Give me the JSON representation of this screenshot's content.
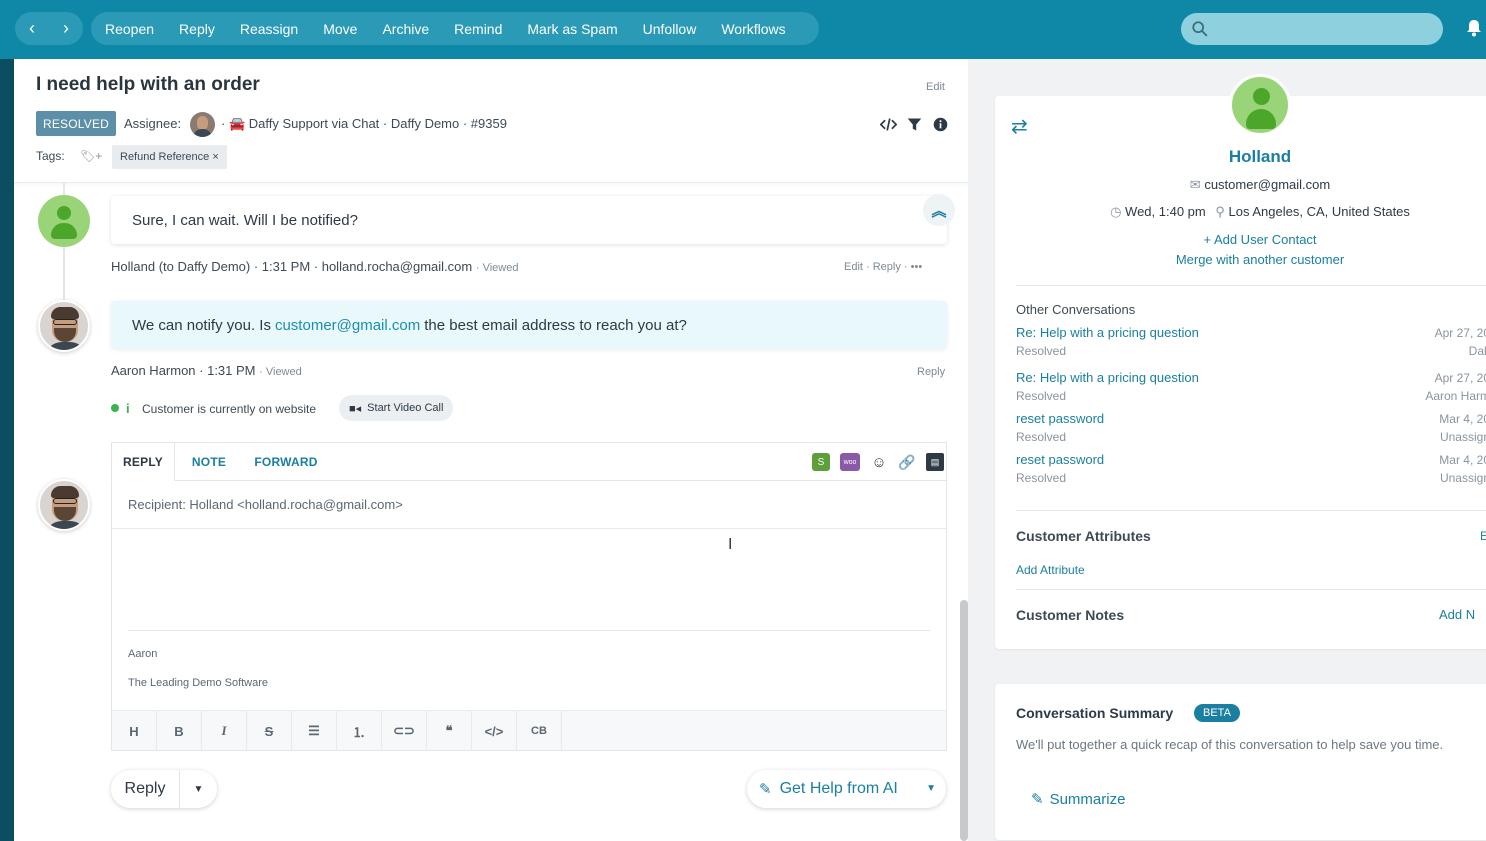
{
  "topbar": {
    "back_icon": "chevron-left-icon",
    "forward_icon": "chevron-right-icon",
    "actions": [
      "Reopen",
      "Reply",
      "Reassign",
      "Move",
      "Archive",
      "Remind",
      "Mark as Spam",
      "Unfollow",
      "Workflows"
    ],
    "search_placeholder": "",
    "accent": "#0f87a6"
  },
  "conversation": {
    "title": "I need help with an order",
    "edit_label": "Edit",
    "status": "RESOLVED",
    "assignee_label": "Assignee:",
    "meta": "· 🚘 Daffy Support via Chat · Daffy Demo · #9359",
    "tags_label": "Tags:",
    "tag_add": "+",
    "tags": [
      "Refund Reference ×"
    ]
  },
  "messages": [
    {
      "text": "Sure, I can wait. Will I be notified?",
      "meta": "Holland (to Daffy Demo) · 1:31 PM · holland.rocha@gmail.com",
      "viewed": "· Viewed",
      "actions": "Edit  ·  Reply  ·  •••"
    },
    {
      "text_before": "We can notify you. Is",
      "link": "customer@gmail.com",
      "text_after": "the best email address to reach you at?",
      "meta": "Aaron Harmon · 1:31 PM",
      "viewed": "· Viewed",
      "actions": "Reply"
    }
  ],
  "presence": {
    "text": "Customer is currently on website",
    "video_button": "Start Video Call"
  },
  "composer": {
    "tabs": [
      "REPLY",
      "NOTE",
      "FORWARD"
    ],
    "recipient": "Recipient: Holland <holland.rocha@gmail.com>",
    "signature_name": "Aaron",
    "signature_company": "The Leading Demo Software",
    "format_buttons": [
      "H",
      "B",
      "I",
      "S",
      "ul",
      "ol",
      "link",
      "quote",
      "code",
      "CB"
    ],
    "reply_button": "Reply",
    "ai_button": "Get Help from AI"
  },
  "customer": {
    "name": "Holland",
    "email": "customer@gmail.com",
    "time": "Wed, 1:40 pm",
    "location": "Los Angeles, CA, United States",
    "add_contact": "+ Add User Contact",
    "merge": "Merge with another customer"
  },
  "other_conversations": {
    "title": "Other Conversations",
    "items": [
      {
        "title": "Re: Help with a pricing question",
        "status": "Resolved",
        "date": "Apr 27, 20",
        "who": "Dak"
      },
      {
        "title": "Re: Help with a pricing question",
        "status": "Resolved",
        "date": "Apr 27, 20",
        "who": "Aaron Harm"
      },
      {
        "title": "reset password",
        "status": "Resolved",
        "date": "Mar 4, 20",
        "who": "Unassign"
      },
      {
        "title": "reset password",
        "status": "Resolved",
        "date": "Mar 4, 20",
        "who": "Unassign"
      }
    ]
  },
  "attributes": {
    "title": "Customer Attributes",
    "edit": "E",
    "add": "Add Attribute"
  },
  "notes": {
    "title": "Customer Notes",
    "add": "Add N"
  },
  "summary": {
    "title": "Conversation Summary",
    "badge": "BETA",
    "description": "We'll put together a quick recap of this conversation to help save you time.",
    "button": "Summarize"
  }
}
